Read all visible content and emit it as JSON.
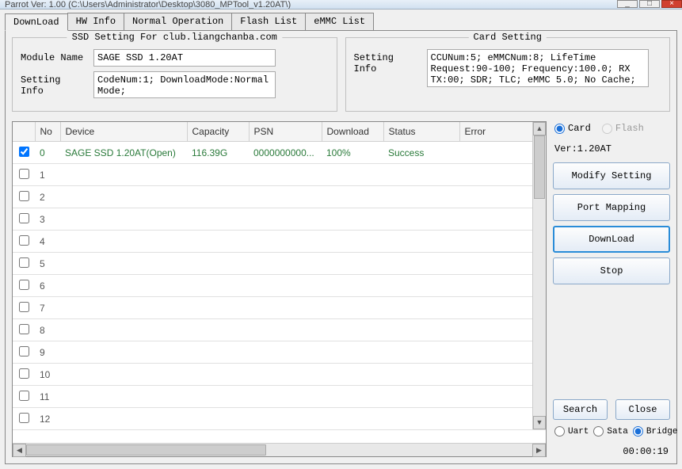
{
  "window": {
    "title": "Parrot Ver: 1.00 (C:\\Users\\Administrator\\Desktop\\3080_MPTool_v1.20AT\\)"
  },
  "tabs": [
    "DownLoad",
    "HW Info",
    "Normal Operation",
    "Flash List",
    "eMMC List"
  ],
  "ssd_group": {
    "legend": "SSD Setting For club.liangchanba.com",
    "module_label": "Module Name",
    "module_value": "SAGE SSD 1.20AT",
    "setting_label": "Setting Info",
    "setting_value": "CodeNum:1; DownloadMode:Normal Mode;"
  },
  "card_group": {
    "legend": "Card Setting",
    "setting_label": "Setting Info",
    "setting_value": "CCUNum:5; eMMCNum:8; LifeTime Request:90-100; Frequency:100.0; RX TX:00; SDR; TLC; eMMC 5.0; No Cache; Type A;"
  },
  "table": {
    "headers": [
      "",
      "No",
      "Device",
      "Capacity",
      "PSN",
      "Download",
      "Status",
      "Error"
    ],
    "rows": [
      {
        "checked": true,
        "no": "0",
        "device": "SAGE SSD 1.20AT(Open)",
        "capacity": "116.39G",
        "psn": "0000000000...",
        "download": "100%",
        "status": "Success",
        "error": ""
      },
      {
        "checked": false,
        "no": "1",
        "device": "",
        "capacity": "",
        "psn": "",
        "download": "",
        "status": "",
        "error": ""
      },
      {
        "checked": false,
        "no": "2",
        "device": "",
        "capacity": "",
        "psn": "",
        "download": "",
        "status": "",
        "error": ""
      },
      {
        "checked": false,
        "no": "3",
        "device": "",
        "capacity": "",
        "psn": "",
        "download": "",
        "status": "",
        "error": ""
      },
      {
        "checked": false,
        "no": "4",
        "device": "",
        "capacity": "",
        "psn": "",
        "download": "",
        "status": "",
        "error": ""
      },
      {
        "checked": false,
        "no": "5",
        "device": "",
        "capacity": "",
        "psn": "",
        "download": "",
        "status": "",
        "error": ""
      },
      {
        "checked": false,
        "no": "6",
        "device": "",
        "capacity": "",
        "psn": "",
        "download": "",
        "status": "",
        "error": ""
      },
      {
        "checked": false,
        "no": "7",
        "device": "",
        "capacity": "",
        "psn": "",
        "download": "",
        "status": "",
        "error": ""
      },
      {
        "checked": false,
        "no": "8",
        "device": "",
        "capacity": "",
        "psn": "",
        "download": "",
        "status": "",
        "error": ""
      },
      {
        "checked": false,
        "no": "9",
        "device": "",
        "capacity": "",
        "psn": "",
        "download": "",
        "status": "",
        "error": ""
      },
      {
        "checked": false,
        "no": "10",
        "device": "",
        "capacity": "",
        "psn": "",
        "download": "",
        "status": "",
        "error": ""
      },
      {
        "checked": false,
        "no": "11",
        "device": "",
        "capacity": "",
        "psn": "",
        "download": "",
        "status": "",
        "error": ""
      },
      {
        "checked": false,
        "no": "12",
        "device": "",
        "capacity": "",
        "psn": "",
        "download": "",
        "status": "",
        "error": ""
      }
    ]
  },
  "side": {
    "mode": {
      "card": "Card",
      "flash": "Flash",
      "selected": "card"
    },
    "ver_label": "Ver:1.20AT",
    "modify": "Modify Setting",
    "portmap": "Port Mapping",
    "download": "DownLoad",
    "stop": "Stop",
    "search": "Search",
    "close": "Close",
    "iface": {
      "uart": "Uart",
      "sata": "Sata",
      "bridge": "Bridge",
      "selected": "bridge"
    },
    "timer": "00:00:19"
  }
}
